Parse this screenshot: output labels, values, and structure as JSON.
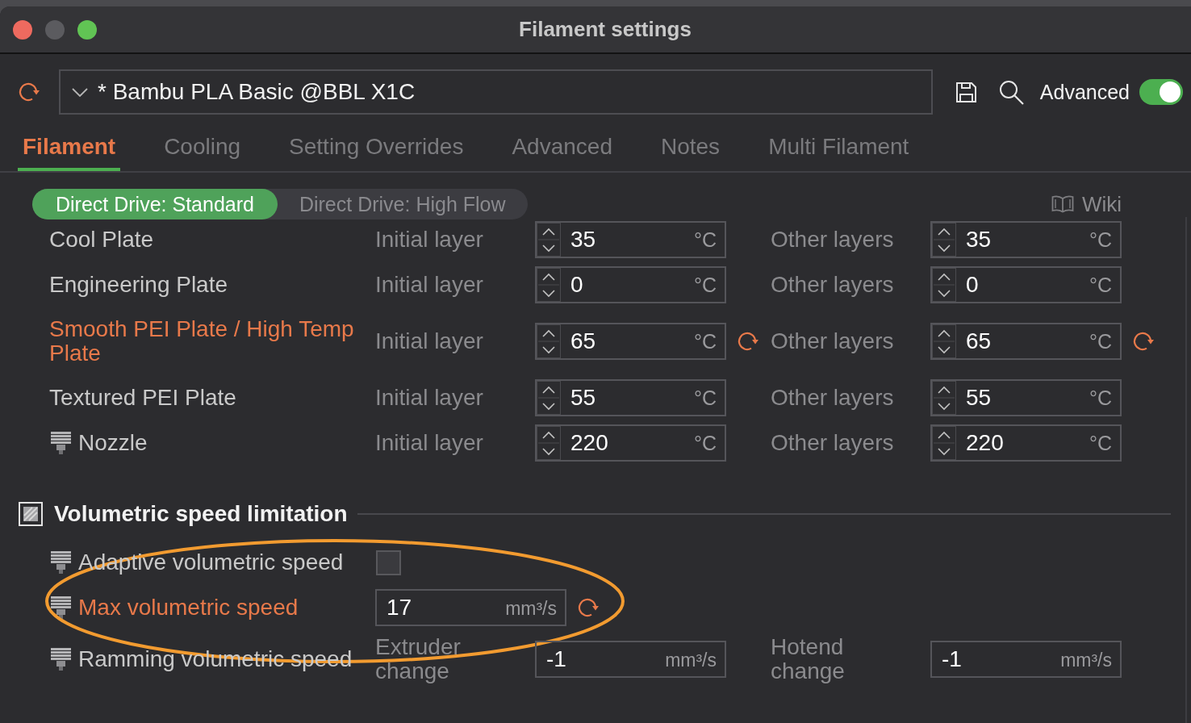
{
  "window": {
    "title": "Filament settings"
  },
  "toolbar": {
    "preset": "* Bambu PLA Basic @BBL X1C",
    "advanced": {
      "label": "Advanced",
      "on": true
    }
  },
  "tabs": [
    {
      "label": "Filament",
      "selected": true
    },
    {
      "label": "Cooling",
      "selected": false
    },
    {
      "label": "Setting Overrides",
      "selected": false
    },
    {
      "label": "Advanced",
      "selected": false
    },
    {
      "label": "Notes",
      "selected": false
    },
    {
      "label": "Multi Filament",
      "selected": false
    }
  ],
  "variants": [
    {
      "label": "Direct Drive: Standard",
      "selected": true
    },
    {
      "label": "Direct Drive: High Flow",
      "selected": false
    }
  ],
  "wiki": {
    "label": "Wiki"
  },
  "plate_rows": [
    {
      "label": "Cool Plate",
      "nozzle_icon": false,
      "modified": false,
      "fields": [
        {
          "kind": "spin",
          "caption": "Initial layer",
          "value": "35",
          "unit": "°C",
          "modified": false
        },
        {
          "kind": "spin",
          "caption": "Other layers",
          "value": "35",
          "unit": "°C",
          "modified": false
        }
      ]
    },
    {
      "label": "Engineering Plate",
      "nozzle_icon": false,
      "modified": false,
      "fields": [
        {
          "kind": "spin",
          "caption": "Initial layer",
          "value": "0",
          "unit": "°C",
          "modified": false
        },
        {
          "kind": "spin",
          "caption": "Other layers",
          "value": "0",
          "unit": "°C",
          "modified": false
        }
      ]
    },
    {
      "label": "Smooth PEI Plate / High Temp Plate",
      "nozzle_icon": false,
      "modified": true,
      "fields": [
        {
          "kind": "spin",
          "caption": "Initial layer",
          "value": "65",
          "unit": "°C",
          "modified": true
        },
        {
          "kind": "spin",
          "caption": "Other layers",
          "value": "65",
          "unit": "°C",
          "modified": true
        }
      ]
    },
    {
      "label": "Textured PEI Plate",
      "nozzle_icon": false,
      "modified": false,
      "fields": [
        {
          "kind": "spin",
          "caption": "Initial layer",
          "value": "55",
          "unit": "°C",
          "modified": false
        },
        {
          "kind": "spin",
          "caption": "Other layers",
          "value": "55",
          "unit": "°C",
          "modified": false
        }
      ]
    },
    {
      "label": "Nozzle",
      "nozzle_icon": true,
      "modified": false,
      "fields": [
        {
          "kind": "spin",
          "caption": "Initial layer",
          "value": "220",
          "unit": "°C",
          "modified": false
        },
        {
          "kind": "spin",
          "caption": "Other layers",
          "value": "220",
          "unit": "°C",
          "modified": false
        }
      ]
    }
  ],
  "sections": [
    {
      "title": "Volumetric speed limitation",
      "rows": [
        {
          "label": "Adaptive volumetric speed",
          "nozzle_icon": true,
          "modified": false,
          "highlighted": false,
          "fields": [
            {
              "kind": "checkbox",
              "checked": false
            }
          ]
        },
        {
          "label": "Max volumetric speed",
          "nozzle_icon": true,
          "modified": true,
          "highlighted": true,
          "fields": [
            {
              "kind": "number",
              "value": "17",
              "unit": "mm³/s",
              "modified": true
            }
          ]
        },
        {
          "label": "Ramming volumetric speed",
          "nozzle_icon": true,
          "modified": false,
          "highlighted": false,
          "fields": [
            {
              "kind": "number",
              "caption": "Extruder change",
              "value": "-1",
              "unit": "mm³/s",
              "modified": false
            },
            {
              "kind": "number",
              "caption": "Hotend change",
              "value": "-1",
              "unit": "mm³/s",
              "modified": false
            }
          ]
        }
      ]
    }
  ]
}
